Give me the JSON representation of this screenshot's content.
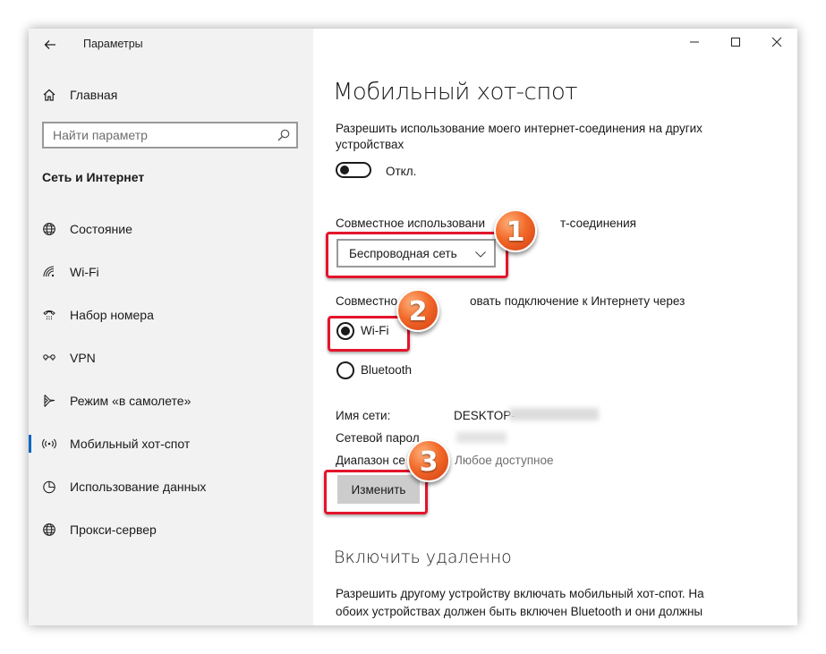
{
  "window": {
    "title": "Параметры",
    "controls": {
      "minimize": "minimize-icon",
      "maximize": "maximize-icon",
      "close": "close-icon"
    }
  },
  "sidebar": {
    "home_label": "Главная",
    "search_placeholder": "Найти параметр",
    "section_title": "Сеть и Интернет",
    "items": [
      {
        "label": "Состояние",
        "icon": "globe-icon"
      },
      {
        "label": "Wi-Fi",
        "icon": "wifi-icon"
      },
      {
        "label": "Набор номера",
        "icon": "dialup-icon"
      },
      {
        "label": "VPN",
        "icon": "vpn-icon"
      },
      {
        "label": "Режим «в самолете»",
        "icon": "airplane-icon"
      },
      {
        "label": "Мобильный хот-спот",
        "icon": "hotspot-icon",
        "active": true
      },
      {
        "label": "Использование данных",
        "icon": "data-usage-icon"
      },
      {
        "label": "Прокси-сервер",
        "icon": "globe-icon"
      }
    ]
  },
  "main": {
    "title": "Мобильный хот-спот",
    "share_desc_line1": "Разрешить использование моего интернет-соединения на других",
    "share_desc_line2": "устройствах",
    "toggle_state": "Откл.",
    "share_from_label_a": "Совместное использовани",
    "share_from_label_b": "т-соединения",
    "share_from_value": "Беспроводная сеть",
    "share_over_label_a": "Совместно",
    "share_over_label_b": "овать подключение к Интернету через",
    "radio_wifi": "Wi-Fi",
    "radio_bluetooth": "Bluetooth",
    "network_name_label": "Имя сети:",
    "network_name_value": "DESKTOP-",
    "password_label": "Сетевой парол",
    "range_label": "Диапазон се",
    "range_value": "Любое доступное",
    "edit_button": "Изменить",
    "remote_title": "Включить удаленно",
    "remote_desc_line1": "Разрешить другому устройству включать мобильный хот-спот. На",
    "remote_desc_line2": "обоих устройствах должен быть включен Bluetooth и они должны"
  },
  "annotations": {
    "step1": "1",
    "step2": "2",
    "step3": "3",
    "highlight_color": "#e3152b",
    "badge_color": "#f26a2a"
  },
  "colors": {
    "sidebar_bg": "#f2f2f2",
    "accent": "#0067c0",
    "button_bg": "#cccccc"
  }
}
